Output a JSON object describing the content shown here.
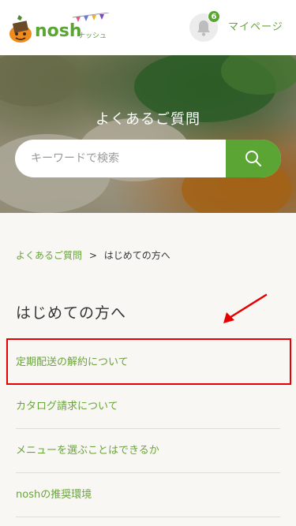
{
  "header": {
    "logo_text": "nosh",
    "logo_subtext": "ナッシュ",
    "notification_count": "6",
    "mypage_label": "マイページ"
  },
  "hero": {
    "title": "よくあるご質問",
    "search_placeholder": "キーワードで検索"
  },
  "breadcrumb": {
    "home": "よくあるご質問",
    "separator": ">",
    "current": "はじめての方へ"
  },
  "section": {
    "title": "はじめての方へ",
    "items": [
      {
        "label": "定期配送の解約について"
      },
      {
        "label": "カタログ請求について"
      },
      {
        "label": "メニューを選ぶことはできるか"
      },
      {
        "label": "noshの推奨環境"
      }
    ]
  },
  "colors": {
    "brand_green": "#5aa534",
    "link_green": "#6aa33d",
    "annotation_red": "#e60000"
  }
}
